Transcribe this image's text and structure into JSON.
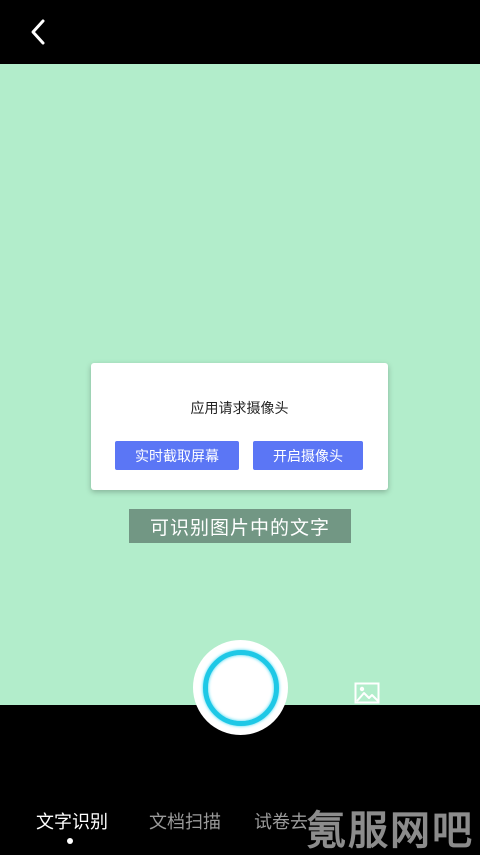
{
  "header": {
    "back_icon": "chevron-left-icon"
  },
  "dialog": {
    "title": "应用请求摄像头",
    "screen_capture_button": "实时截取屏幕",
    "open_camera_button": "开启摄像头",
    "button_color": "#5b76f5"
  },
  "camera": {
    "background_color": "#b2edcb",
    "hint": "可识别图片中的文字"
  },
  "controls": {
    "shutter_icon": "shutter-button",
    "gallery_icon": "image-icon",
    "accent_color": "#1ec8e6"
  },
  "tabs": [
    {
      "label": "文字识别",
      "active": true
    },
    {
      "label": "文档扫描",
      "active": false
    },
    {
      "label": "试卷去",
      "active": false
    }
  ],
  "watermark": "氪服网吧"
}
